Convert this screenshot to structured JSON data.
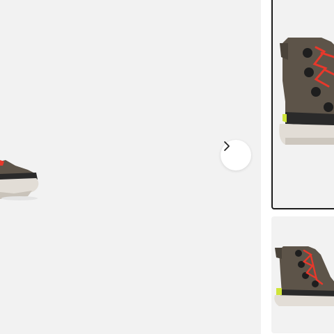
{
  "gallery": {
    "main_image": {
      "icon": "boot-image"
    },
    "next_button": {
      "icon": "chevron-right-icon"
    },
    "thumbnails": [
      {
        "icon": "boot-image",
        "selected": true
      },
      {
        "icon": "boot-image",
        "selected": false
      }
    ]
  },
  "colors": {
    "background": "#f2f2f2",
    "boot_upper": "#5d5449",
    "boot_sole": "#e2ddd6",
    "boot_band": "#2a2a2a",
    "lace": "#e8382b",
    "eyelet": "#1e1e1e",
    "accent": "#cfe43a",
    "selected_border": "#1a1a1a"
  }
}
